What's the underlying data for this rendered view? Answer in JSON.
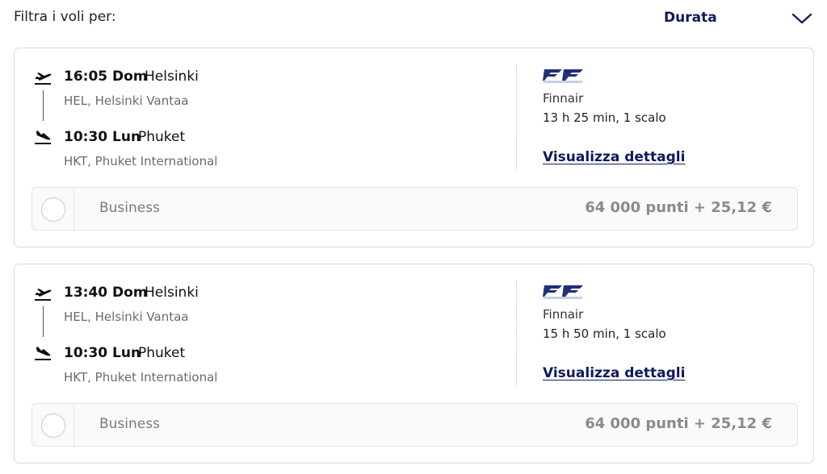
{
  "filter": {
    "label": "Filtra i voli per:",
    "sort_value": "Durata"
  },
  "colors": {
    "brand_navy": "#0e1a5e",
    "muted_text": "#6b6b6b",
    "card_border": "#d8d8d8"
  },
  "flights": [
    {
      "departure": {
        "time": "16:05 Dom",
        "city": "Helsinki",
        "airport": "HEL, Helsinki Vantaa"
      },
      "arrival": {
        "time": "10:30 Lun",
        "city": "Phuket",
        "airport": "HKT, Phuket International"
      },
      "airline": "Finnair",
      "duration": "13 h 25 min, 1 scalo",
      "details_link": "Visualizza dettagli",
      "fare": {
        "class": "Business",
        "price": "64 000 punti + 25,12 €"
      }
    },
    {
      "departure": {
        "time": "13:40 Dom",
        "city": "Helsinki",
        "airport": "HEL, Helsinki Vantaa"
      },
      "arrival": {
        "time": "10:30 Lun",
        "city": "Phuket",
        "airport": "HKT, Phuket International"
      },
      "airline": "Finnair",
      "duration": "15 h 50 min, 1 scalo",
      "details_link": "Visualizza dettagli",
      "fare": {
        "class": "Business",
        "price": "64 000 punti + 25,12 €"
      }
    }
  ],
  "icons": {
    "departure": "plane-takeoff-icon",
    "arrival": "plane-landing-icon",
    "sort_toggle": "chevron-down-icon",
    "airline": "finnair-logo-icon"
  }
}
